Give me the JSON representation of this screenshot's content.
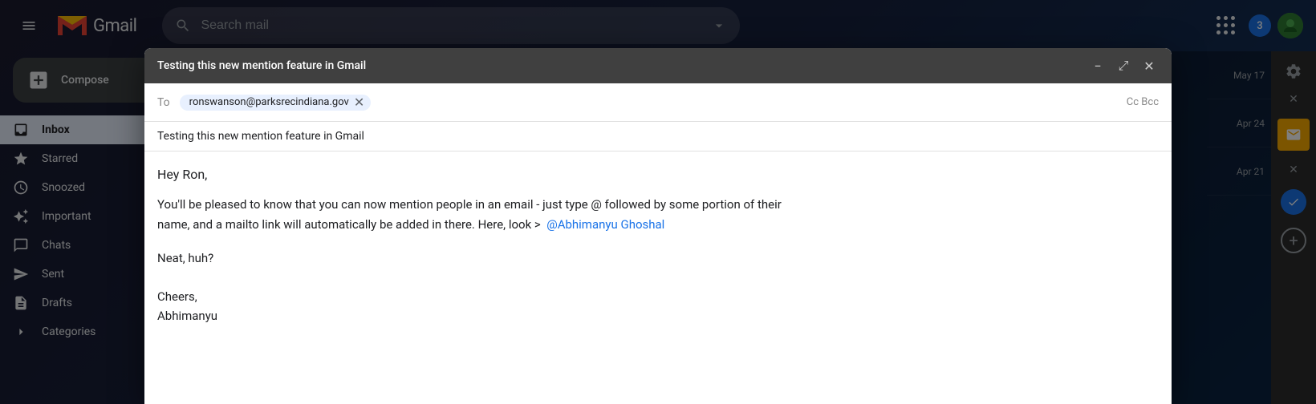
{
  "app": {
    "title": "Gmail",
    "logo_alt": "Gmail"
  },
  "topbar": {
    "menu_label": "Menu",
    "search_placeholder": "Search mail",
    "notification_count": "3",
    "avatar_initial": ""
  },
  "sidebar": {
    "compose_label": "Compose",
    "nav_items": [
      {
        "id": "inbox",
        "label": "Inbox",
        "icon": "inbox"
      },
      {
        "id": "starred",
        "label": "Starred",
        "icon": "star"
      },
      {
        "id": "snoozed",
        "label": "Snoozed",
        "icon": "clock"
      },
      {
        "id": "important",
        "label": "Important",
        "icon": "label-important"
      },
      {
        "id": "chats",
        "label": "Chats",
        "icon": "chat"
      },
      {
        "id": "sent",
        "label": "Sent",
        "icon": "send"
      },
      {
        "id": "drafts",
        "label": "Drafts",
        "icon": "draft"
      },
      {
        "id": "categories",
        "label": "Categories",
        "icon": "chevron-right"
      }
    ]
  },
  "compose_window": {
    "title": "Testing this new mention feature in Gmail",
    "minimize_label": "Minimize",
    "expand_label": "Expand",
    "close_label": "Close",
    "to_label": "To",
    "recipient_email": "ronswanson@parksrecindiana.gov",
    "cc_label": "Cc",
    "bcc_label": "Bcc",
    "subject": "Testing this new mention feature in Gmail",
    "body_greeting": "Hey Ron,",
    "body_line1": "You'll be pleased to know that you can now mention people in an email - just type @ followed by some portion of their",
    "body_line2": "name, and a mailto link will automatically be added in there. Here, look >",
    "mention_text": "@Abhimanyu Ghoshal",
    "mention_href": "mailto:abhimanyu@example.com",
    "body_neat": "Neat, huh?",
    "sign_off": "Cheers,",
    "signature": "Abhimanyu"
  },
  "email_list": {
    "dates": [
      {
        "date": "May 17"
      },
      {
        "date": "Apr 24"
      },
      {
        "date": "Apr 21"
      }
    ]
  },
  "right_panel": {
    "settings_label": "Settings",
    "close_label": "Close",
    "add_label": "Add"
  }
}
